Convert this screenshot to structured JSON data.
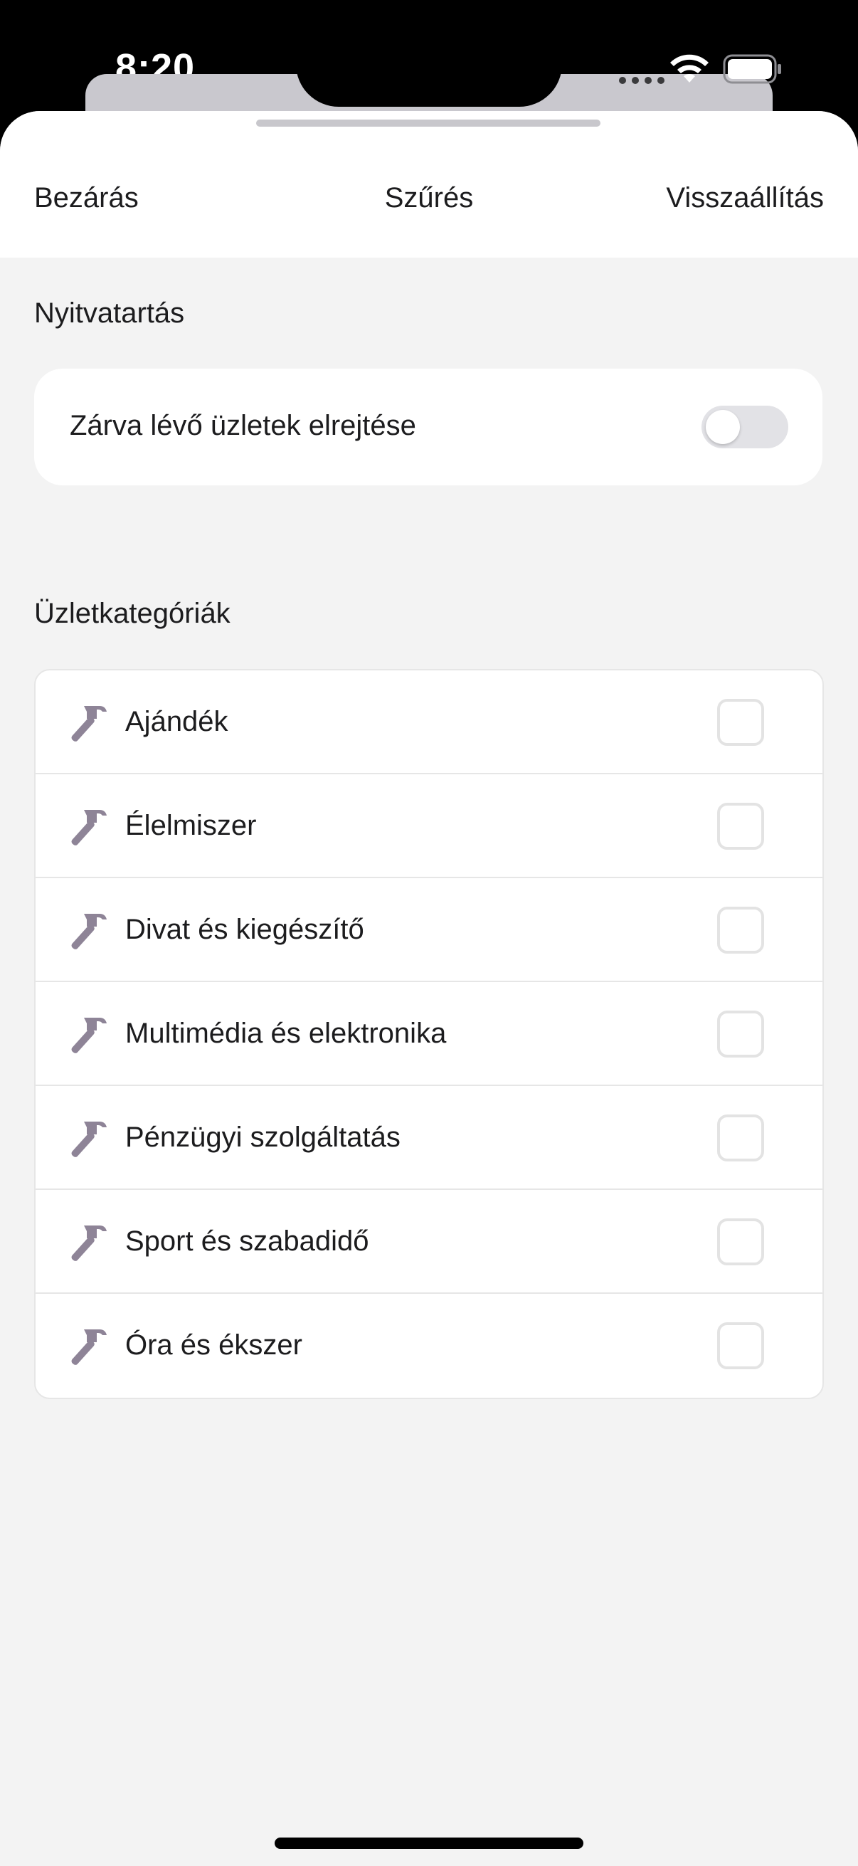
{
  "status_bar": {
    "time": "8:20"
  },
  "header": {
    "close_label": "Bezárás",
    "title": "Szűrés",
    "reset_label": "Visszaállítás"
  },
  "opening_hours": {
    "section_title": "Nyitvatartás",
    "toggle_label": "Zárva lévő üzletek elrejtése",
    "toggle_on": false
  },
  "categories": {
    "section_title": "Üzletkategóriák",
    "icon": "hammer-icon",
    "items": [
      {
        "label": "Ajándék",
        "checked": false
      },
      {
        "label": "Élelmiszer",
        "checked": false
      },
      {
        "label": "Divat és kiegészítő",
        "checked": false
      },
      {
        "label": "Multimédia és elektronika",
        "checked": false
      },
      {
        "label": "Pénzügyi szolgáltatás",
        "checked": false
      },
      {
        "label": "Sport és szabadidő",
        "checked": false
      },
      {
        "label": "Óra és ékszer",
        "checked": false
      }
    ]
  },
  "colors": {
    "sheet_background": "#f3f3f3",
    "card_background": "#ffffff",
    "icon_color": "#8e8497",
    "text": "#1c1c1e"
  }
}
